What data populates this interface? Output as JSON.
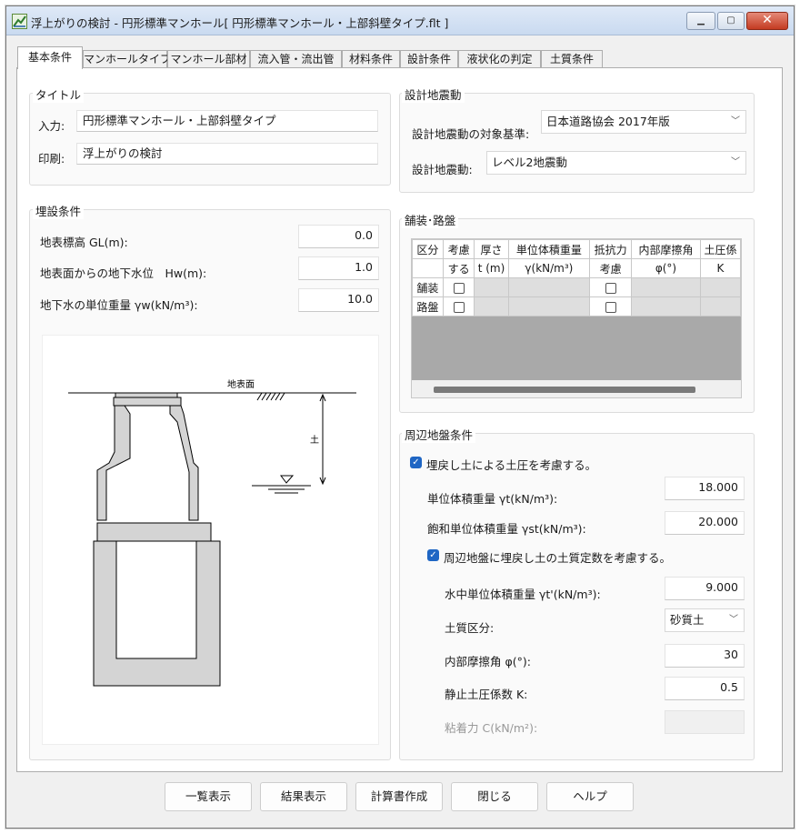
{
  "window": {
    "title": "浮上がりの検討 - 円形標準マンホール[ 円形標準マンホール・上部斜壁タイプ.flt ]",
    "minimize_glyph": "▁",
    "maximize_glyph": "▢",
    "close_glyph": "✕"
  },
  "tabs": [
    {
      "label": "基本条件"
    },
    {
      "label": "マンホールタイプ"
    },
    {
      "label": "マンホール部材"
    },
    {
      "label": "流入管・流出管"
    },
    {
      "label": "材料条件"
    },
    {
      "label": "設計条件"
    },
    {
      "label": "液状化の判定"
    },
    {
      "label": "土質条件"
    }
  ],
  "title_group": {
    "heading": "タイトル",
    "input_label": "入力:",
    "input_value": "円形標準マンホール・上部斜壁タイプ",
    "print_label": "印刷:",
    "print_value": "浮上がりの検討"
  },
  "burial": {
    "heading": "埋設条件",
    "gl_label": "地表標高 GL(m):",
    "gl_value": "0.0",
    "hw_label": "地表面からの地下水位　Hw(m):",
    "hw_value": "1.0",
    "gw_label": "地下水の単位重量 γw(kN/m³):",
    "gw_value": "10.0"
  },
  "diagram": {
    "ground_label": "地表面",
    "depth_label": "土"
  },
  "seismic": {
    "heading": "設計地震動",
    "standard_label": "設計地震動の対象基準:",
    "standard_value": "日本道路協会 2017年版",
    "motion_label": "設計地震動:",
    "motion_value": "レベル2地震動",
    "chevron": "﹀"
  },
  "pavement": {
    "heading": "舗装･路盤",
    "header_row1": [
      "区分",
      "考慮",
      "厚さ",
      "単位体積重量",
      "抵抗力",
      "内部摩擦角",
      "土圧係"
    ],
    "header_row2": [
      "",
      "する",
      "t (m)",
      "γ(kN/m³)",
      "考慮",
      "φ(°)",
      "K"
    ],
    "rows": [
      {
        "name": "舗装"
      },
      {
        "name": "路盤"
      }
    ]
  },
  "surrounding": {
    "heading": "周辺地盤条件",
    "backfill_check": "埋戻し土による土圧を考慮する。",
    "gt_label": "単位体積重量 γt(kN/m³):",
    "gt_value": "18.000",
    "gst_label": "飽和単位体積重量 γst(kN/m³):",
    "gst_value": "20.000",
    "soil_const_check": "周辺地盤に埋戻し土の土質定数を考慮する。",
    "gtp_label": "水中単位体積重量 γt'(kN/m³):",
    "gtp_value": "9.000",
    "soil_type_label": "土質区分:",
    "soil_type_value": "砂質土",
    "phi_label": "内部摩擦角 φ(°):",
    "phi_value": "30",
    "k_label": "静止土圧係数 K:",
    "k_value": "0.5",
    "c_label": "粘着力 C(kN/m²):",
    "c_value": "",
    "check_glyph": "✓"
  },
  "buttons": {
    "list": "一覧表示",
    "result": "結果表示",
    "report": "計算書作成",
    "close": "閉じる",
    "help": "ヘルプ"
  }
}
